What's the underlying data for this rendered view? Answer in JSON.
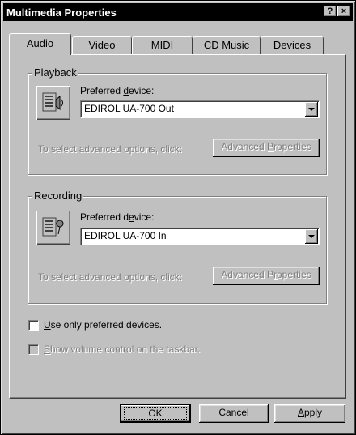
{
  "window": {
    "title": "Multimedia Properties",
    "help_label": "?",
    "close_label": "×"
  },
  "tabs": [
    {
      "label": "Audio",
      "active": true
    },
    {
      "label": "Video",
      "active": false
    },
    {
      "label": "MIDI",
      "active": false
    },
    {
      "label": "CD Music",
      "active": false
    },
    {
      "label": "Devices",
      "active": false
    }
  ],
  "playback": {
    "group_label": "Playback",
    "preferred_label_pre": "Preferred ",
    "preferred_label_key": "d",
    "preferred_label_post": "evice:",
    "device_value": "EDIROL UA-700 Out",
    "advanced_hint": "To select advanced options, click:",
    "advanced_button_pre": "Advanced ",
    "advanced_button_key": "P",
    "advanced_button_post": "roperties"
  },
  "recording": {
    "group_label": "Recording",
    "preferred_label_pre": "Preferred d",
    "preferred_label_key": "e",
    "preferred_label_post": "vice:",
    "device_value": "EDIROL UA-700 In",
    "advanced_hint": "To select advanced options, click:",
    "advanced_button_pre": "Advanced P",
    "advanced_button_key": "r",
    "advanced_button_post": "operties"
  },
  "options": {
    "use_preferred_key": "U",
    "use_preferred_rest": "se only preferred devices.",
    "show_volume_key": "S",
    "show_volume_rest": "how volume control on the taskbar."
  },
  "footer": {
    "ok_label": "OK",
    "cancel_label": "Cancel",
    "apply_key": "A",
    "apply_rest": "pply"
  }
}
